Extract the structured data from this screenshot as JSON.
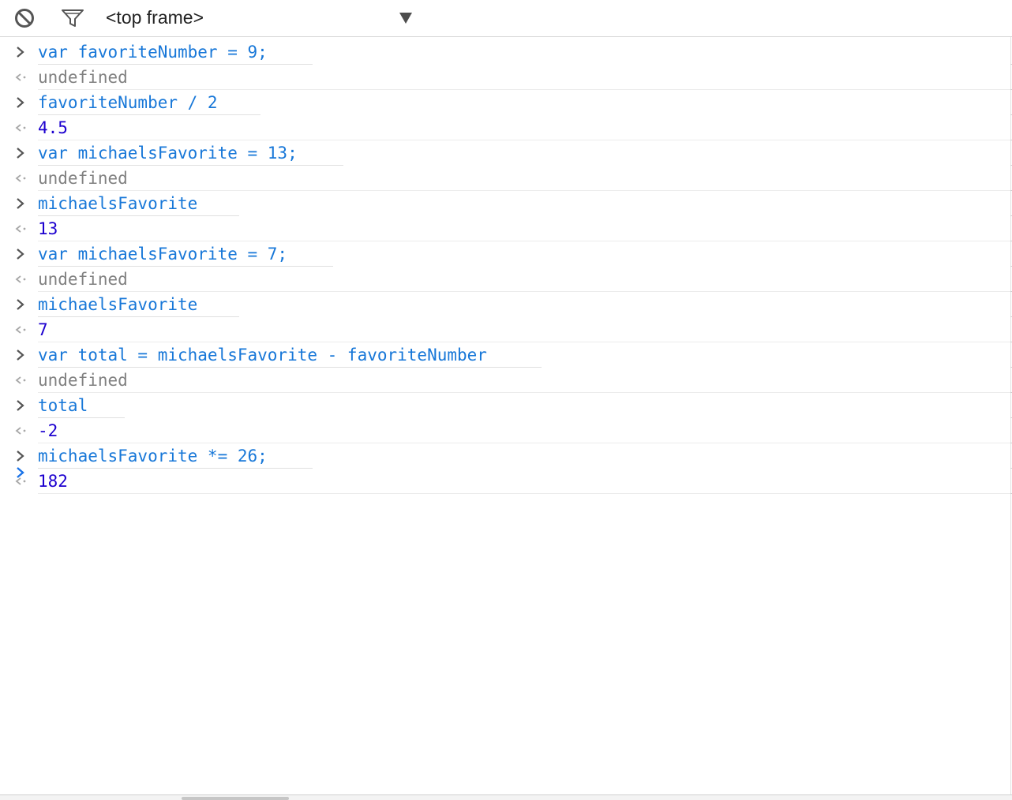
{
  "toolbar": {
    "clear_icon": "clear-console-icon",
    "filter_icon": "funnel-filter-icon",
    "frame_selector": "<top frame>",
    "dropdown_icon": "triangle-down-icon"
  },
  "console": {
    "entries": [
      {
        "kind": "input",
        "text": "var favoriteNumber = 9;"
      },
      {
        "kind": "output",
        "text": "undefined"
      },
      {
        "kind": "input",
        "text": "favoriteNumber / 2"
      },
      {
        "kind": "output",
        "text": "4.5"
      },
      {
        "kind": "input",
        "text": "var michaelsFavorite = 13;"
      },
      {
        "kind": "output",
        "text": "undefined"
      },
      {
        "kind": "input",
        "text": "michaelsFavorite"
      },
      {
        "kind": "output",
        "text": "13"
      },
      {
        "kind": "input",
        "text": "var michaelsFavorite = 7;"
      },
      {
        "kind": "output",
        "text": "undefined"
      },
      {
        "kind": "input",
        "text": "michaelsFavorite"
      },
      {
        "kind": "output",
        "text": "7"
      },
      {
        "kind": "input",
        "text": "var total = michaelsFavorite - favoriteNumber"
      },
      {
        "kind": "output",
        "text": "undefined"
      },
      {
        "kind": "input",
        "text": "total"
      },
      {
        "kind": "output",
        "text": "-2"
      },
      {
        "kind": "input",
        "text": "michaelsFavorite *= 26;"
      },
      {
        "kind": "output",
        "text": "182"
      }
    ],
    "prompt_value": ""
  },
  "colors": {
    "input_text": "#1777d8",
    "output_undefined": "#808080",
    "output_number": "#1c00cf",
    "prompt_arrow": "#1a73e8"
  }
}
